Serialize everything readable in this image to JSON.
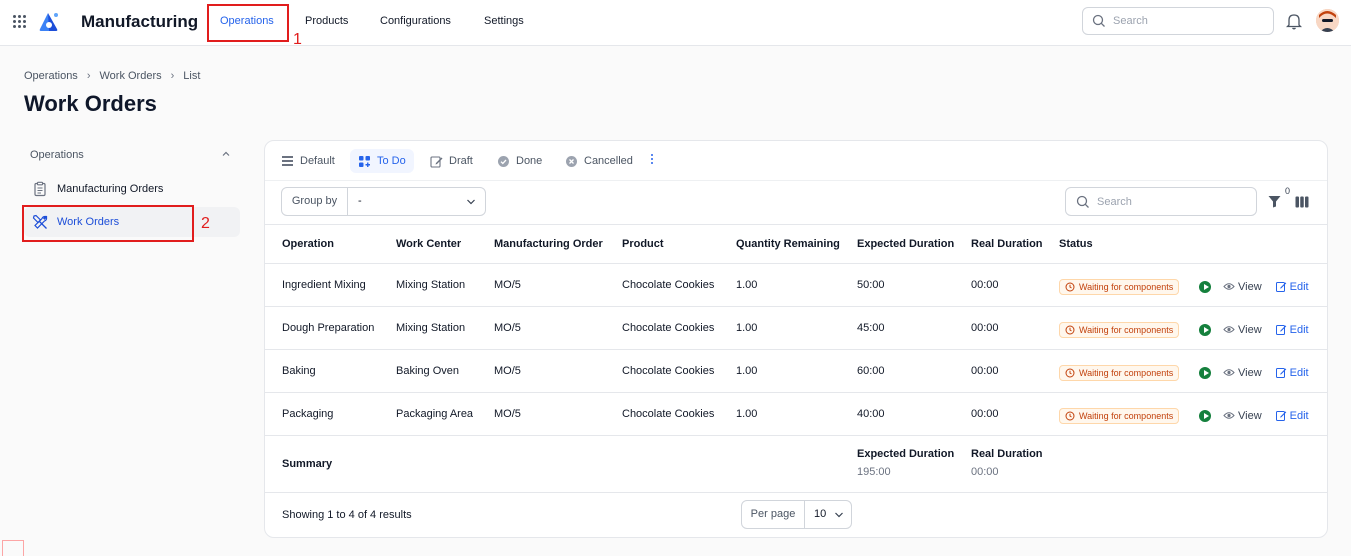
{
  "app": {
    "title": "Manufacturing"
  },
  "nav": {
    "items": [
      {
        "label": "Operations",
        "active": true
      },
      {
        "label": "Products"
      },
      {
        "label": "Configurations"
      },
      {
        "label": "Settings"
      }
    ]
  },
  "top_search": {
    "placeholder": "Search"
  },
  "annotations": {
    "first": "1",
    "second": "2"
  },
  "breadcrumb": [
    "Operations",
    "Work Orders",
    "List"
  ],
  "page_title": "Work Orders",
  "sidebar": {
    "group": "Operations",
    "items": [
      {
        "label": "Manufacturing Orders"
      },
      {
        "label": "Work Orders",
        "active": true
      }
    ]
  },
  "tabs": [
    {
      "label": "Default",
      "icon": "list-icon"
    },
    {
      "label": "To Do",
      "icon": "todo-icon",
      "active": true
    },
    {
      "label": "Draft",
      "icon": "pencil-icon"
    },
    {
      "label": "Done",
      "icon": "check-circle-icon"
    },
    {
      "label": "Cancelled",
      "icon": "x-circle-icon"
    }
  ],
  "toolbar": {
    "group_by_label": "Group by",
    "group_by_value": "-",
    "search_placeholder": "Search",
    "filter_count": "0"
  },
  "table": {
    "headers": [
      "Operation",
      "Work Center",
      "Manufacturing Order",
      "Product",
      "Quantity Remaining",
      "Expected Duration",
      "Real Duration",
      "Status"
    ],
    "rows": [
      {
        "operation": "Ingredient Mixing",
        "work_center": "Mixing Station",
        "mo": "MO/5",
        "product": "Chocolate Cookies",
        "qty": "1.00",
        "expected": "50:00",
        "real": "00:00",
        "status": "Waiting for components"
      },
      {
        "operation": "Dough Preparation",
        "work_center": "Mixing Station",
        "mo": "MO/5",
        "product": "Chocolate Cookies",
        "qty": "1.00",
        "expected": "45:00",
        "real": "00:00",
        "status": "Waiting for components"
      },
      {
        "operation": "Baking",
        "work_center": "Baking Oven",
        "mo": "MO/5",
        "product": "Chocolate Cookies",
        "qty": "1.00",
        "expected": "60:00",
        "real": "00:00",
        "status": "Waiting for components"
      },
      {
        "operation": "Packaging",
        "work_center": "Packaging Area",
        "mo": "MO/5",
        "product": "Chocolate Cookies",
        "qty": "1.00",
        "expected": "40:00",
        "real": "00:00",
        "status": "Waiting for components"
      }
    ],
    "actions": {
      "view": "View",
      "edit": "Edit"
    },
    "summary": {
      "label": "Summary",
      "expected_label": "Expected Duration",
      "expected_value": "195:00",
      "real_label": "Real Duration",
      "real_value": "00:00"
    }
  },
  "footer": {
    "showing": "Showing 1 to 4 of 4 results",
    "per_page_label": "Per page",
    "per_page_value": "10"
  },
  "colors": {
    "accent": "#2563eb",
    "annotation": "#e11d1d",
    "status": "#c2410c",
    "play": "#15803d"
  }
}
